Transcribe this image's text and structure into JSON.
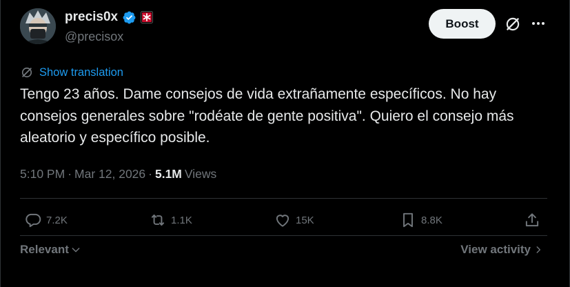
{
  "author": {
    "display_name": "precis0x",
    "handle": "@precisox"
  },
  "actions_top": {
    "boost_label": "Boost"
  },
  "translation": {
    "link_label": "Show translation"
  },
  "tweet": {
    "text": "Tengo 23 años. Dame consejos de vida extrañamente específicos. No hay consejos generales sobre \"rodéate de gente positiva\". Quiero el consejo más aleatorio y específico posible."
  },
  "meta": {
    "time": "5:10 PM",
    "sep1": "·",
    "date": "Mar 12, 2026",
    "sep2": "·",
    "views_count": "5.1M",
    "views_label": "Views"
  },
  "stats": {
    "replies": "7.2K",
    "reposts": "1.1K",
    "likes": "15K",
    "bookmarks": "8.8K"
  },
  "footer": {
    "sort_label": "Relevant",
    "activity_label": "View activity"
  },
  "colors": {
    "background": "#000000",
    "text": "#e7e9ea",
    "muted": "#71767b",
    "link": "#1d9bf0",
    "verified": "#1d9bf0",
    "divider": "#2f3336"
  }
}
